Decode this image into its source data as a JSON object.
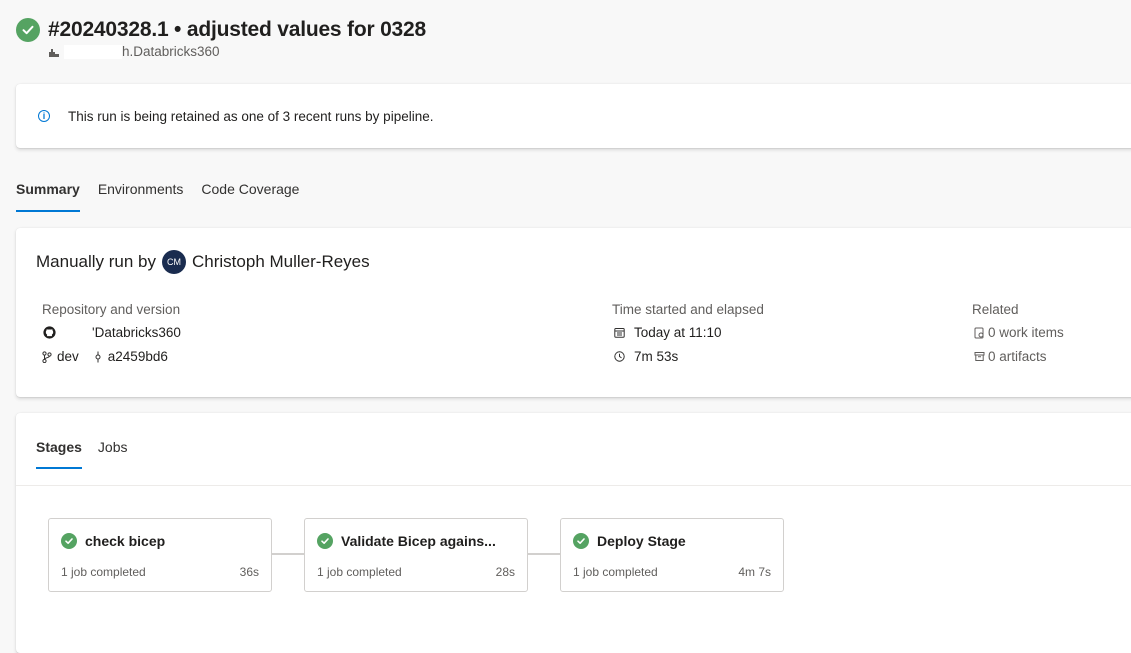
{
  "header": {
    "title": "#20240328.1 • adjusted values for 0328",
    "pipeline": "h.Databricks360",
    "status_icon": "check-circle-icon",
    "success_color": "#55a362"
  },
  "info": {
    "text": "This run is being retained as one of 3 recent runs by pipeline."
  },
  "tabs": [
    {
      "label": "Summary",
      "active": true
    },
    {
      "label": "Environments",
      "active": false
    },
    {
      "label": "Code Coverage",
      "active": false
    }
  ],
  "summary": {
    "run_by_prefix": "Manually run by",
    "avatar_initials": "CM",
    "user": "Christoph Muller-Reyes",
    "repo": {
      "heading": "Repository and version",
      "name": "'Databricks360",
      "branch": "dev",
      "commit": "a2459bd6"
    },
    "time": {
      "heading": "Time started and elapsed",
      "started": "Today at 11:10",
      "elapsed": "7m 53s"
    },
    "related": {
      "heading": "Related",
      "work_items": "0 work items",
      "artifacts": "0 artifacts"
    }
  },
  "stage_tabs": [
    {
      "label": "Stages",
      "active": true
    },
    {
      "label": "Jobs",
      "active": false
    }
  ],
  "stages": [
    {
      "name": "check bicep",
      "jobs": "1 job completed",
      "duration": "36s"
    },
    {
      "name": "Validate Bicep agains...",
      "jobs": "1 job completed",
      "duration": "28s"
    },
    {
      "name": "Deploy Stage",
      "jobs": "1 job completed",
      "duration": "4m 7s"
    }
  ],
  "accent_color": "#0078d4"
}
